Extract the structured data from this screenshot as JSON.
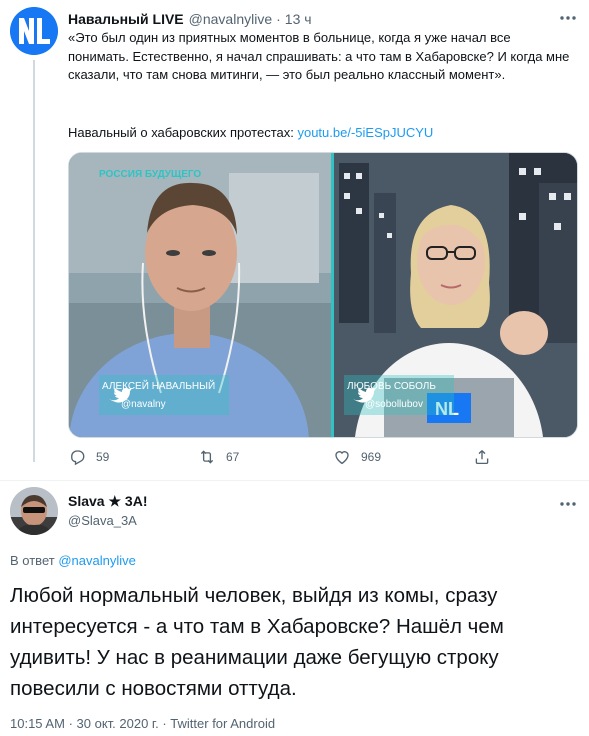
{
  "tweet1": {
    "author_name": "Навальный LIVE",
    "handle": "@navalnylive",
    "separator": "·",
    "time": "13 ч",
    "text": "«Это был один из приятных моментов в больнице, когда я уже начал все понимать. Естественно, я начал спрашивать: а что там в Хабаровске? И когда мне сказали, что там снова митинги, — это был реально классный момент».",
    "link_prefix": "Навальный о хабаровских протестах: ",
    "link_text": "youtu.be/-5iESpJUCYU",
    "media": {
      "overlay_top_left": "РОССИЯ БУДУЩЕГО",
      "left_caption_name": "АЛЕКСЕЙ НАВАЛЬНЫЙ",
      "left_caption_handle": "@navalny",
      "right_caption_name": "ЛЮБОВЬ СОБОЛЬ",
      "right_caption_handle": "@sobollubov",
      "laptop_logo": "NL"
    },
    "replies_count": "59",
    "retweets_count": "67",
    "likes_count": "969"
  },
  "tweet2": {
    "author_name": "Slava ★ 3A!",
    "handle": "@Slava_3A",
    "reply_prefix": "В ответ ",
    "reply_mention": "@navalnylive",
    "text": "Любой нормальный человек, выйдя из комы, сразу интересуется - а что там в Хабаровске? Нашёл чем удивить! У нас в реанимации даже бегущую строку повесили с новостями оттуда.",
    "time": "10:15 AM",
    "date": "30 окт. 2020 г.",
    "source": "Twitter for Android",
    "meta_sep": "·"
  },
  "colors": {
    "accent": "#1d9bf0",
    "secondary_text": "#536471",
    "primary_text": "#0f1419",
    "divider": "#eff3f4",
    "teal_caption": "#2ec4c4"
  },
  "icons": [
    "more-icon",
    "reply-icon",
    "retweet-icon",
    "like-icon",
    "share-icon",
    "twitter-bird-icon"
  ]
}
